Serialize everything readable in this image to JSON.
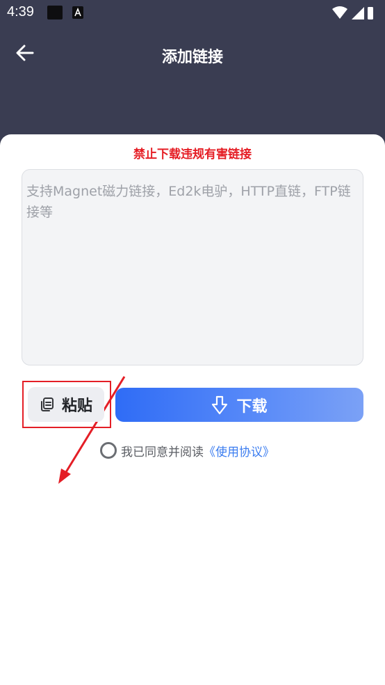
{
  "status_bar": {
    "time": "4:39"
  },
  "app_bar": {
    "title": "添加链接"
  },
  "warning": "禁止下载违规有害链接",
  "link_input": {
    "value": "",
    "placeholder": "支持Magnet磁力链接，Ed2k电驴，HTTP直链，FTP链接等"
  },
  "paste_button": {
    "label": "粘贴"
  },
  "download_button": {
    "label": "下载"
  },
  "agreement": {
    "text": "我已同意并阅读",
    "link": "《使用协议》",
    "checked": false
  },
  "colors": {
    "header_bg": "#3a3d52",
    "warning": "#e51d24",
    "accent": "#2f6cf6",
    "link": "#3a7cf0",
    "annotation": "#e41e26"
  }
}
